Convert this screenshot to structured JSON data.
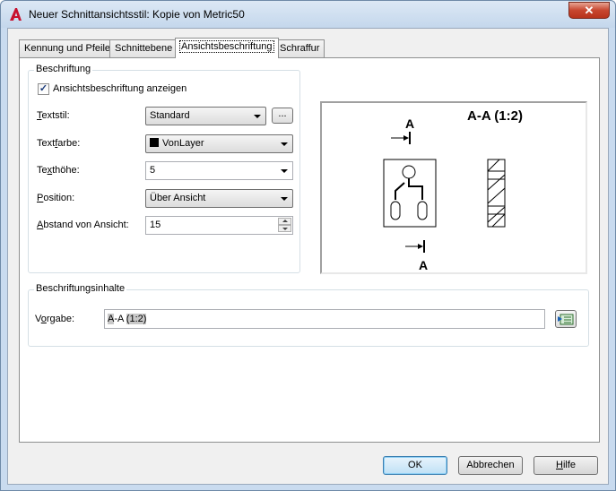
{
  "window": {
    "title": "Neuer Schnittansichtsstil: Kopie von Metric50",
    "close_glyph": "✕"
  },
  "tabs": [
    {
      "label": "Kennung und Pfeile"
    },
    {
      "label": "Schnittebene"
    },
    {
      "label": "Ansichtsbeschriftung",
      "active": true
    },
    {
      "label": "Schraffur"
    }
  ],
  "beschriftung": {
    "group_title": "Beschriftung",
    "show_label": "Ansichtsbeschriftung anzeigen",
    "show_checked": true,
    "check_glyph": "✓",
    "textstil": {
      "label_pre": "",
      "label_u": "T",
      "label_post": "extstil:",
      "value": "Standard",
      "browse": "..."
    },
    "textfarbe": {
      "label_pre": "Text",
      "label_u": "f",
      "label_post": "arbe:",
      "value": "VonLayer",
      "swatch_color": "#000000"
    },
    "texthoehe": {
      "label_pre": "Te",
      "label_u": "x",
      "label_post": "thöhe:",
      "value": "5"
    },
    "position": {
      "label_pre": "",
      "label_u": "P",
      "label_post": "osition:",
      "value": "Über Ansicht"
    },
    "abstand": {
      "label_pre": "",
      "label_u": "A",
      "label_post": "bstand von Ansicht:",
      "value": "15"
    }
  },
  "preview": {
    "title": "A-A (1:2)",
    "marker_top": "A",
    "marker_bottom": "A"
  },
  "inhalte": {
    "group_title": "Beschriftungsinhalte",
    "vorgabe_label_pre": "V",
    "vorgabe_label_u": "o",
    "vorgabe_label_post": "rgabe:",
    "value_hl1": "A",
    "value_plain": "-A ",
    "value_hl2": "(1:2)"
  },
  "buttons": {
    "ok": "OK",
    "cancel": "Abbrechen",
    "help_pre": "",
    "help_u": "H",
    "help_post": "ilfe"
  },
  "colors": {
    "accent": "#3c7fb1",
    "app_icon": "#c8102e"
  },
  "icons": [
    "autocad-app-icon",
    "close-icon",
    "chevron-down-icon",
    "spin-up-icon",
    "spin-down-icon",
    "insert-field-icon",
    "checkmark-icon"
  ]
}
